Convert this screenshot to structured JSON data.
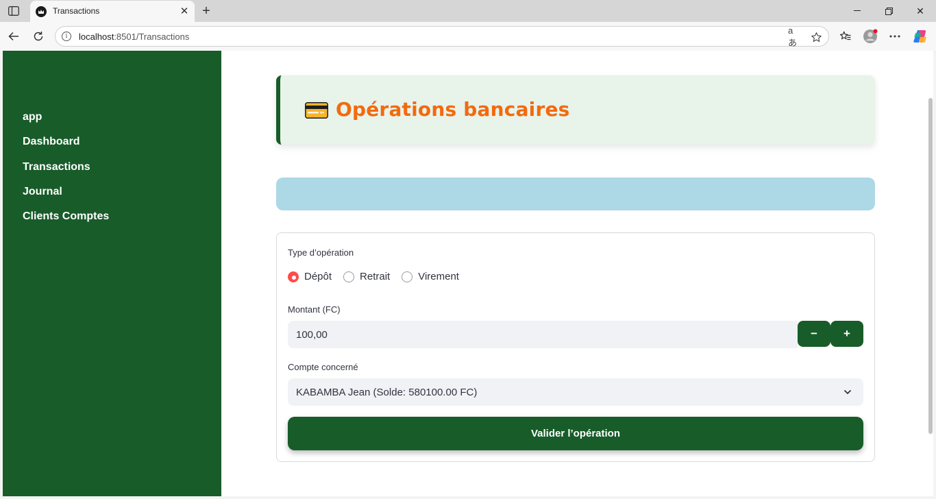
{
  "browser": {
    "tab_title": "Transactions",
    "url_host": "localhost",
    "url_rest": ":8501/Transactions",
    "translate_glyph": "aあ"
  },
  "sidebar": {
    "items": [
      {
        "label": "app"
      },
      {
        "label": "Dashboard"
      },
      {
        "label": "Transactions"
      },
      {
        "label": "Journal"
      },
      {
        "label": "Clients Comptes"
      }
    ]
  },
  "header": {
    "emoji": "credit-card-icon",
    "title": "Opérations bancaires"
  },
  "form": {
    "type_label": "Type d’opération",
    "operation_types": [
      {
        "label": "Dépôt",
        "selected": true
      },
      {
        "label": "Retrait",
        "selected": false
      },
      {
        "label": "Virement",
        "selected": false
      }
    ],
    "amount_label": "Montant (FC)",
    "amount_value": "100,00",
    "minus_label": "−",
    "plus_label": "+",
    "account_label": "Compte concerné",
    "account_value": "KABAMBA Jean (Solde: 580100.00 FC)",
    "submit_label": "Valider l’opération"
  },
  "colors": {
    "sidebar_bg": "#185c29",
    "title_orange": "#f26a0e",
    "info_bar": "#add8e6",
    "radio_selected": "#ff4b4b"
  }
}
